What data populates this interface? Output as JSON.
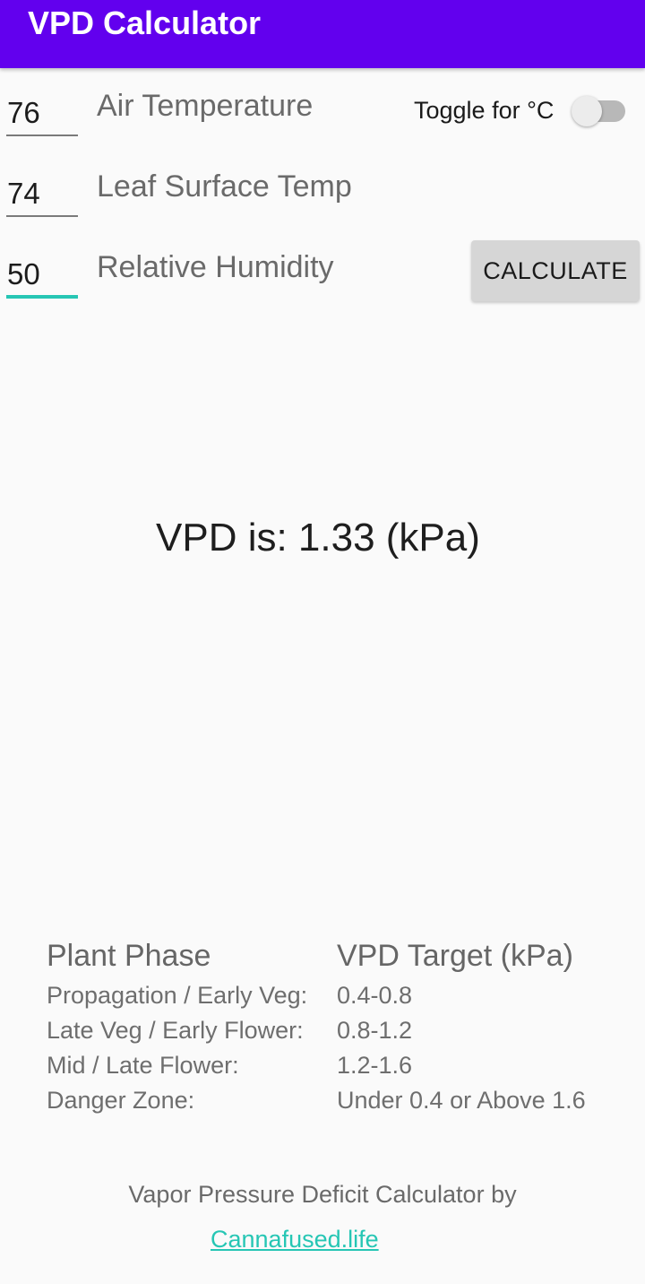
{
  "appbar": {
    "title": "VPD Calculator",
    "color": "#6200ee"
  },
  "inputs": [
    {
      "value": "76",
      "label": "Air Temperature"
    },
    {
      "value": "74",
      "label": "Leaf Surface Temp"
    },
    {
      "value": "50",
      "label": "Relative Humidity",
      "focused": true
    }
  ],
  "toggle": {
    "label": "Toggle for °C",
    "checked": false
  },
  "calculate_button": {
    "label": "CALCULATE"
  },
  "result": {
    "text": "VPD is: 1.33 (kPa)",
    "value": 1.33,
    "unit": "kPa"
  },
  "phase_table": {
    "headers": [
      "Plant Phase",
      "VPD Target (kPa)"
    ],
    "rows": [
      {
        "phase": "Propagation / Early Veg:",
        "target": "0.4-0.8"
      },
      {
        "phase": "Late Veg / Early Flower:",
        "target": "0.8-1.2"
      },
      {
        "phase": "Mid / Late Flower:",
        "target": "1.2-1.6"
      },
      {
        "phase": "Danger Zone:",
        "target": "Under 0.4 or Above 1.6"
      }
    ]
  },
  "footer": {
    "text": "Vapor Pressure Deficit Calculator by",
    "link_label": "Cannafused.life",
    "link_color": "#26c6b4"
  }
}
